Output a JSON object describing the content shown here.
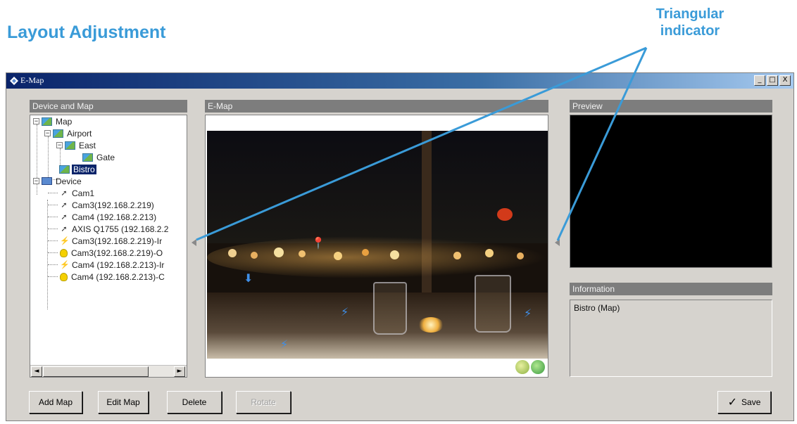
{
  "document": {
    "title": "Layout Adjustment",
    "callout_line1": "Triangular",
    "callout_line2": "indicator"
  },
  "window": {
    "title": "E-Map",
    "minimize": "_",
    "maximize": "□",
    "close": "X"
  },
  "panels": {
    "device_and_map": "Device and Map",
    "emap": "E-Map",
    "preview": "Preview",
    "information": "Information"
  },
  "tree": {
    "map": "Map",
    "airport": "Airport",
    "east": "East",
    "gate": "Gate",
    "bistro": "Bistro",
    "device": "Device",
    "devices": [
      {
        "label": "Cam1",
        "icon": "camera-icon"
      },
      {
        "label": "Cam3(192.168.2.219)",
        "icon": "camera-icon"
      },
      {
        "label": "Cam4 (192.168.2.213)",
        "icon": "camera-icon"
      },
      {
        "label": "AXIS Q1755 (192.168.2.2",
        "icon": "camera-icon"
      },
      {
        "label": "Cam3(192.168.2.219)-Ir",
        "icon": "input-trigger-icon"
      },
      {
        "label": "Cam3(192.168.2.219)-O",
        "icon": "output-bulb-icon"
      },
      {
        "label": "Cam4 (192.168.2.213)-Ir",
        "icon": "input-trigger-icon"
      },
      {
        "label": "Cam4 (192.168.2.213)-C",
        "icon": "output-bulb-icon"
      }
    ]
  },
  "scrollbar": {
    "left": "◄",
    "right": "►"
  },
  "information_text": "Bistro (Map)",
  "buttons": {
    "add_map": "Add Map",
    "edit_map": "Edit Map",
    "delete": "Delete",
    "rotate": "Rotate",
    "save": "Save",
    "save_check": "✓"
  },
  "colors": {
    "accent": "#3a9bd8",
    "titlebar": "#0a246a",
    "panel_header": "#7d7d7d",
    "selection": "#0a246a",
    "marker": "#3f8fe8"
  }
}
